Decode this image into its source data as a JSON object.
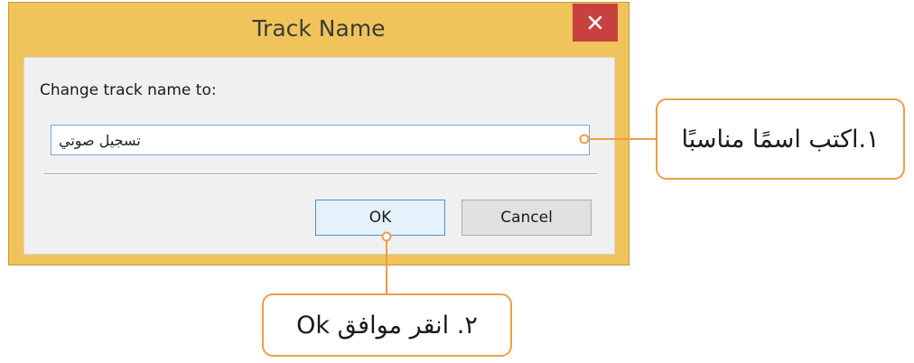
{
  "dialog": {
    "title": "Track Name",
    "close_icon": "close-icon",
    "prompt_label": "Change track name to:",
    "name_value": "تسجيل صوتي",
    "ok_label": "OK",
    "cancel_label": "Cancel"
  },
  "callouts": {
    "step1": "١.اكتب اسمًا مناسبًا",
    "step2": "٢. انقر موافق Ok"
  },
  "colors": {
    "window_frame": "#f0c45b",
    "close_button": "#c7413f",
    "callout_border": "#ee9c4a",
    "input_border": "#7aa7d8"
  }
}
